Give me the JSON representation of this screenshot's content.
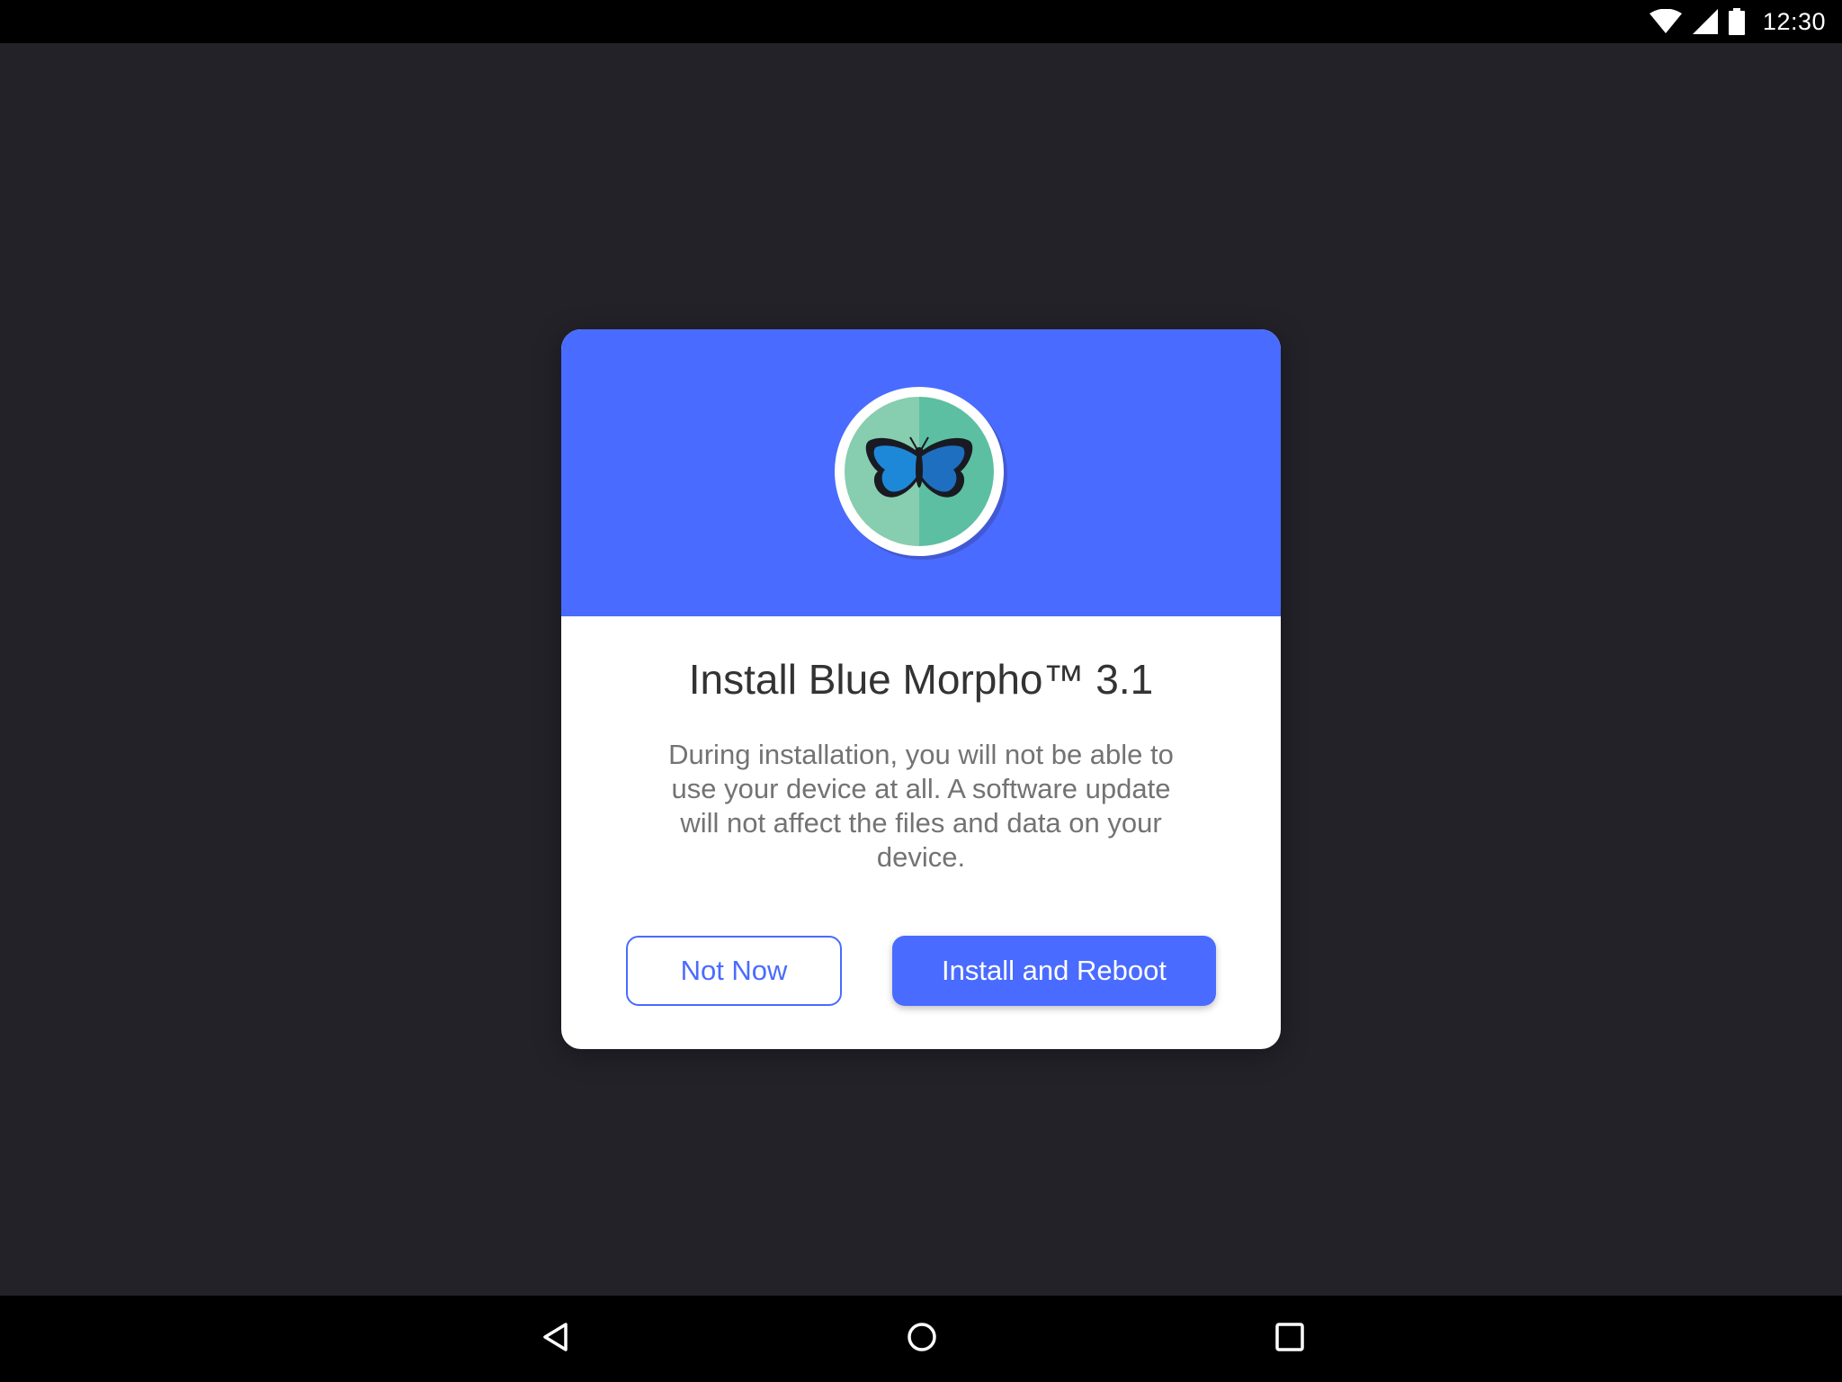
{
  "status_bar": {
    "time": "12:30",
    "icons": [
      "wifi-icon",
      "signal-icon",
      "battery-icon"
    ]
  },
  "dialog": {
    "app_icon": "butterfly-icon",
    "title": "Install Blue Morpho™ 3.1",
    "body": "During installation, you will not be able to use your device at all. A software update will not affect the files and data on your device.",
    "secondary_button": "Not Now",
    "primary_button": "Install and Reboot"
  },
  "nav_bar": {
    "icons": [
      "back-icon",
      "home-icon",
      "recents-icon"
    ]
  },
  "colors": {
    "background": "#232229",
    "accent": "#4a6bff",
    "icon_teal_light": "#87cdb0",
    "icon_teal_dark": "#5cbfa2",
    "butterfly_blue": "#1e88d8"
  }
}
